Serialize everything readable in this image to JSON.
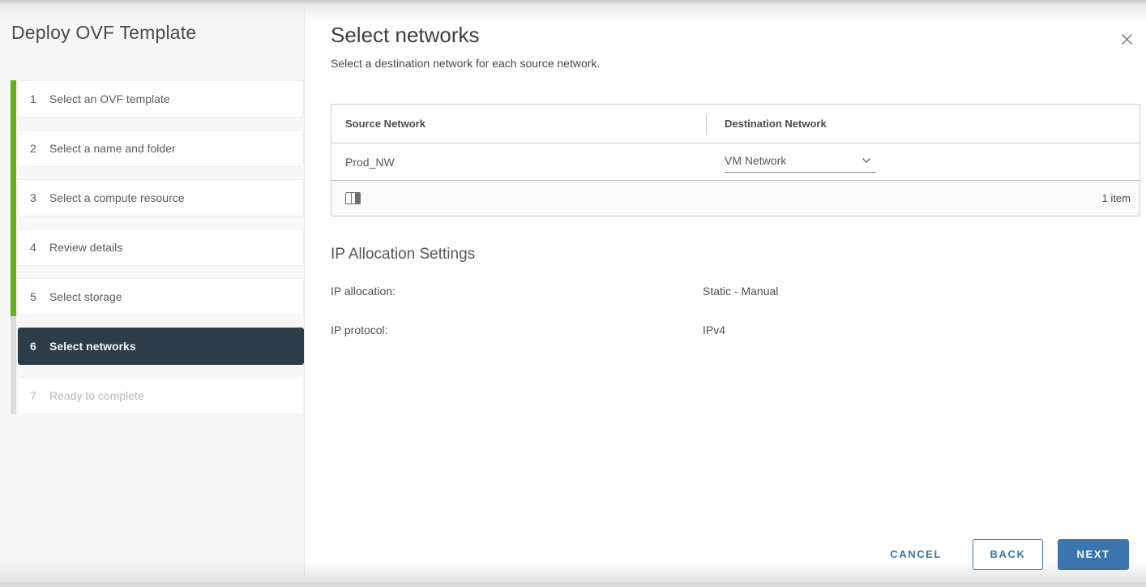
{
  "dialog": {
    "title": "Deploy OVF Template"
  },
  "steps": [
    {
      "number": "1",
      "label": "Select an OVF template",
      "state": "completed"
    },
    {
      "number": "2",
      "label": "Select a name and folder",
      "state": "completed"
    },
    {
      "number": "3",
      "label": "Select a compute resource",
      "state": "completed"
    },
    {
      "number": "4",
      "label": "Review details",
      "state": "completed"
    },
    {
      "number": "5",
      "label": "Select storage",
      "state": "completed"
    },
    {
      "number": "6",
      "label": "Select networks",
      "state": "active"
    },
    {
      "number": "7",
      "label": "Ready to complete",
      "state": "disabled"
    }
  ],
  "content": {
    "title": "Select networks",
    "subtitle": "Select a destination network for each source network.",
    "table": {
      "columns": [
        "Source Network",
        "Destination Network"
      ],
      "rows": [
        {
          "source": "Prod_NW",
          "destination": "VM Network"
        }
      ],
      "footer": {
        "count": "1 item"
      }
    },
    "ip_allocation": {
      "heading": "IP Allocation Settings",
      "rows": [
        {
          "label": "IP allocation:",
          "value": "Static - Manual"
        },
        {
          "label": "IP protocol:",
          "value": "IPv4"
        }
      ]
    }
  },
  "footer_buttons": {
    "cancel": "CANCEL",
    "back": "BACK",
    "next": "NEXT"
  },
  "icons": {
    "close": "close-icon",
    "dropdown": "chevron-down-icon",
    "column_picker": "columns-icon"
  },
  "colors": {
    "accent_blue": "#3577b1",
    "accent_blue_fill": "#3a76ad",
    "active_step_bg": "#2d3c49",
    "progress_green": "#60b515"
  }
}
